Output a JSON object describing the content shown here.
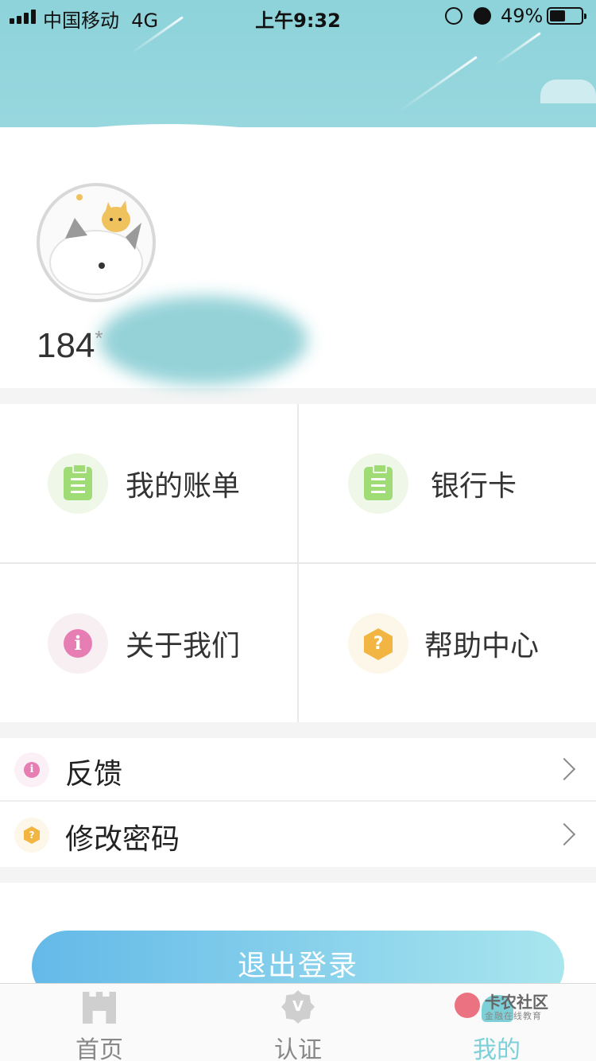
{
  "status_bar": {
    "carrier": "中国移动",
    "network": "4G",
    "time": "上午9:32",
    "battery_percent": "49%",
    "battery_level": 0.49
  },
  "profile": {
    "phone_visible": "184",
    "phone_mask": "*"
  },
  "grid": [
    {
      "label": "我的账单",
      "icon": "clipboard-icon",
      "icon_color": "#9fdc75"
    },
    {
      "label": "银行卡",
      "icon": "clipboard-icon",
      "icon_color": "#9fdc75"
    },
    {
      "label": "关于我们",
      "icon": "info-icon",
      "icon_color": "#e77eb3"
    },
    {
      "label": "帮助中心",
      "icon": "help-icon",
      "icon_color": "#f2b542"
    }
  ],
  "icons": {
    "info_glyph": "i",
    "help_glyph": "?",
    "verify_glyph": "V"
  },
  "list": [
    {
      "label": "反馈",
      "icon": "info-icon"
    },
    {
      "label": "修改密码",
      "icon": "help-icon"
    }
  ],
  "logout_label": "退出登录",
  "tabbar": [
    {
      "label": "首页",
      "icon": "home-icon",
      "active": false
    },
    {
      "label": "认证",
      "icon": "verify-icon",
      "active": false
    },
    {
      "label": "我的",
      "icon": "user-icon",
      "active": true
    }
  ],
  "watermark": {
    "title": "卡农社区",
    "subtitle": "金融在线教育"
  },
  "colors": {
    "header": "#8ed3da",
    "accent": "#7dd0d8",
    "logout_start": "#63b9e8",
    "logout_end": "#a9e6ee"
  }
}
